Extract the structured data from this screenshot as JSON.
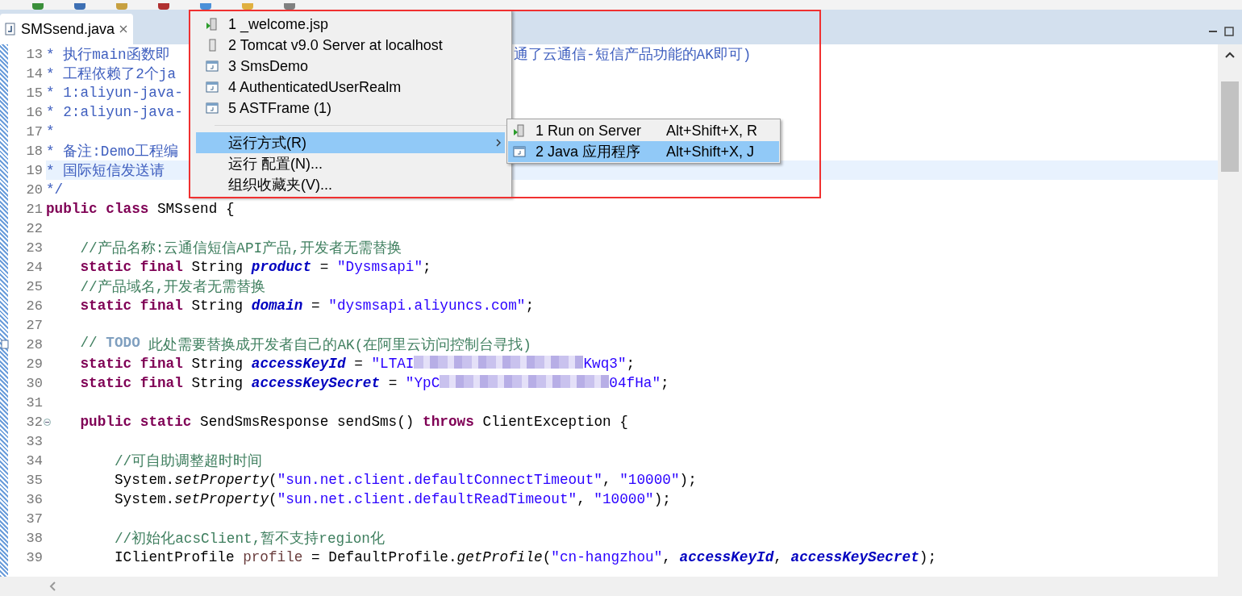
{
  "editor_tab": {
    "title": "SMSsend.java",
    "selected": true
  },
  "lines": [
    {
      "number": "13",
      "current": false,
      "tokens": [
        {
          "kind": "doc",
          "text": "* 执行main函数即"
        }
      ],
      "tail": "通了云通信-短信产品功能的AK即可)"
    },
    {
      "number": "14",
      "current": false,
      "tokens": [
        {
          "kind": "doc",
          "text": "* 工程依赖了2个ja"
        }
      ]
    },
    {
      "number": "15",
      "current": false,
      "tokens": [
        {
          "kind": "doc",
          "text": "* 1:aliyun-java-"
        }
      ]
    },
    {
      "number": "16",
      "current": false,
      "tokens": [
        {
          "kind": "doc",
          "text": "* 2:aliyun-java-"
        }
      ]
    },
    {
      "number": "17",
      "current": false,
      "tokens": [
        {
          "kind": "doc",
          "text": "*"
        }
      ]
    },
    {
      "number": "18",
      "current": false,
      "tokens": [
        {
          "kind": "doc",
          "text": "* 备注:Demo工程编"
        }
      ]
    },
    {
      "number": "19",
      "current": true,
      "tokens": [
        {
          "kind": "doc",
          "text": "* 国际短信发送请"
        }
      ]
    },
    {
      "number": "20",
      "current": false,
      "tokens": [
        {
          "kind": "doc",
          "text": "*/"
        }
      ]
    },
    {
      "number": "21",
      "current": false,
      "tokens": [
        {
          "kind": "kw",
          "text": "public class"
        },
        {
          "kind": "plain",
          "text": " SMSsend {"
        }
      ]
    },
    {
      "number": "22",
      "current": false
    },
    {
      "number": "23",
      "current": false,
      "tokens": [
        {
          "kind": "comment",
          "text": "    //产品名称:云通信短信API产品,开发者无需替换"
        }
      ]
    },
    {
      "number": "24",
      "current": false,
      "tokens": [
        {
          "kind": "kw",
          "text": "    static final"
        },
        {
          "kind": "plain",
          "text": " String "
        },
        {
          "kind": "field",
          "text": "product"
        },
        {
          "kind": "plain",
          "text": " = "
        },
        {
          "kind": "str",
          "text": "\"Dysmsapi\""
        },
        {
          "kind": "plain",
          "text": ";"
        }
      ]
    },
    {
      "number": "25",
      "current": false,
      "tokens": [
        {
          "kind": "comment",
          "text": "    //产品域名,开发者无需替换"
        }
      ]
    },
    {
      "number": "26",
      "current": false,
      "tokens": [
        {
          "kind": "kw",
          "text": "    static final"
        },
        {
          "kind": "plain",
          "text": " String "
        },
        {
          "kind": "field",
          "text": "domain"
        },
        {
          "kind": "plain",
          "text": " = "
        },
        {
          "kind": "str",
          "text": "\"dysmsapi.aliyuncs.com\""
        },
        {
          "kind": "plain",
          "text": ";"
        }
      ]
    },
    {
      "number": "27",
      "current": false
    },
    {
      "number": "28",
      "current": false,
      "task": true,
      "tokens": [
        {
          "kind": "comment",
          "text": "    //"
        },
        {
          "kind": "todo",
          "text": " TODO"
        },
        {
          "kind": "comment",
          "text": " 此处需要替换成开发者自己的AK(在阿里云访问控制台寻找)"
        }
      ]
    },
    {
      "number": "29",
      "current": false,
      "tokens": [
        {
          "kind": "kw",
          "text": "    static final"
        },
        {
          "kind": "plain",
          "text": " String "
        },
        {
          "kind": "field",
          "text": "accessKeyId"
        },
        {
          "kind": "plain",
          "text": " = "
        },
        {
          "kind": "str",
          "text": "\"LTAI"
        },
        {
          "kind": "redacted"
        },
        {
          "kind": "str",
          "text": "Kwq3\""
        },
        {
          "kind": "plain",
          "text": ";"
        }
      ]
    },
    {
      "number": "30",
      "current": false,
      "tokens": [
        {
          "kind": "kw",
          "text": "    static final"
        },
        {
          "kind": "plain",
          "text": " String "
        },
        {
          "kind": "field",
          "text": "accessKeySecret"
        },
        {
          "kind": "plain",
          "text": " = "
        },
        {
          "kind": "str",
          "text": "\"YpC"
        },
        {
          "kind": "redacted"
        },
        {
          "kind": "str",
          "text": "04fHa\""
        },
        {
          "kind": "plain",
          "text": ";"
        }
      ]
    },
    {
      "number": "31",
      "current": false
    },
    {
      "number": "32",
      "current": false,
      "folded": false,
      "tokens": [
        {
          "kind": "kw",
          "text": "    public static"
        },
        {
          "kind": "plain",
          "text": " SendSmsResponse sendSms() "
        },
        {
          "kind": "kw",
          "text": "throws"
        },
        {
          "kind": "plain",
          "text": " ClientException {"
        }
      ]
    },
    {
      "number": "33",
      "current": false
    },
    {
      "number": "34",
      "current": false,
      "tokens": [
        {
          "kind": "comment",
          "text": "        //可自助调整超时时间"
        }
      ]
    },
    {
      "number": "35",
      "current": false,
      "tokens": [
        {
          "kind": "plain",
          "text": "        System."
        },
        {
          "kind": "method",
          "text": "setProperty"
        },
        {
          "kind": "plain",
          "text": "("
        },
        {
          "kind": "str",
          "text": "\"sun.net.client.defaultConnectTimeout\""
        },
        {
          "kind": "plain",
          "text": ", "
        },
        {
          "kind": "str",
          "text": "\"10000\""
        },
        {
          "kind": "plain",
          "text": ");"
        }
      ]
    },
    {
      "number": "36",
      "current": false,
      "tokens": [
        {
          "kind": "plain",
          "text": "        System."
        },
        {
          "kind": "method",
          "text": "setProperty"
        },
        {
          "kind": "plain",
          "text": "("
        },
        {
          "kind": "str",
          "text": "\"sun.net.client.defaultReadTimeout\""
        },
        {
          "kind": "plain",
          "text": ", "
        },
        {
          "kind": "str",
          "text": "\"10000\""
        },
        {
          "kind": "plain",
          "text": ");"
        }
      ]
    },
    {
      "number": "37",
      "current": false
    },
    {
      "number": "38",
      "current": false,
      "tokens": [
        {
          "kind": "comment",
          "text": "        //初始化acsClient,暂不支持region化"
        }
      ]
    },
    {
      "number": "39",
      "current": false,
      "tokens": [
        {
          "kind": "plain",
          "text": "        IClientProfile "
        },
        {
          "kind": "local",
          "text": "profile"
        },
        {
          "kind": "plain",
          "text": " = DefaultProfile."
        },
        {
          "kind": "method",
          "text": "getProfile"
        },
        {
          "kind": "plain",
          "text": "("
        },
        {
          "kind": "str",
          "text": "\"cn-hangzhou\""
        },
        {
          "kind": "plain",
          "text": ", "
        },
        {
          "kind": "field",
          "text": "accessKeyId"
        },
        {
          "kind": "plain",
          "text": ", "
        },
        {
          "kind": "field",
          "text": "accessKeySecret"
        },
        {
          "kind": "plain",
          "text": ");"
        }
      ]
    }
  ],
  "menu": {
    "items": [
      {
        "kind": "server_launch",
        "label": "1 _welcome.jsp",
        "selected": false
      },
      {
        "kind": "server",
        "label": "2 Tomcat v9.0 Server at localhost",
        "selected": false
      },
      {
        "kind": "java_app",
        "label": "3 SmsDemo",
        "selected": false
      },
      {
        "kind": "java_app",
        "label": "4 AuthenticatedUserRealm",
        "selected": false
      },
      {
        "kind": "java_app",
        "label": "5 ASTFrame (1)",
        "selected": false
      },
      {
        "kind": "separator"
      },
      {
        "kind": "submenu",
        "label": "运行方式(R)",
        "selected": true
      },
      {
        "kind": "action",
        "label": "运行 配置(N)...",
        "selected": false
      },
      {
        "kind": "action",
        "label": "组织收藏夹(V)...",
        "selected": false
      }
    ]
  },
  "submenu": {
    "items": [
      {
        "kind": "server_launch",
        "label": "1 Run on Server",
        "shortcut": "Alt+Shift+X, R",
        "selected": false
      },
      {
        "kind": "java_app",
        "label": "2 Java 应用程序",
        "shortcut": "Alt+Shift+X, J",
        "selected": true
      }
    ]
  }
}
